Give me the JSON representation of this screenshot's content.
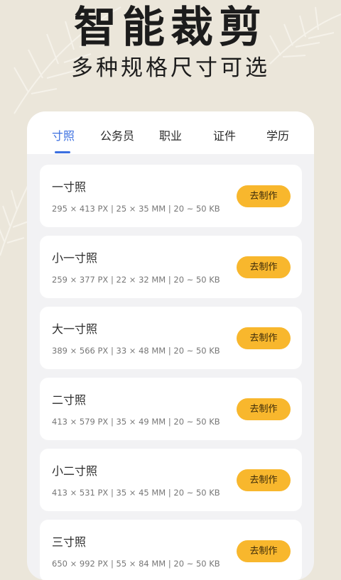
{
  "hero": {
    "title": "智能裁剪",
    "subtitle": "多种规格尺寸可选"
  },
  "tabs": [
    {
      "label": "寸照",
      "active": true
    },
    {
      "label": "公务员",
      "active": false
    },
    {
      "label": "职业",
      "active": false
    },
    {
      "label": "证件",
      "active": false
    },
    {
      "label": "学历",
      "active": false
    }
  ],
  "items": [
    {
      "title": "一寸照",
      "spec": "295 × 413 PX | 25 × 35 MM | 20 ~ 50 KB",
      "button": "去制作"
    },
    {
      "title": "小一寸照",
      "spec": "259 × 377 PX | 22 × 32 MM | 20 ~ 50 KB",
      "button": "去制作"
    },
    {
      "title": "大一寸照",
      "spec": "389 × 566 PX | 33 × 48 MM | 20 ~ 50 KB",
      "button": "去制作"
    },
    {
      "title": "二寸照",
      "spec": "413 × 579 PX | 35 × 49 MM | 20 ~ 50 KB",
      "button": "去制作"
    },
    {
      "title": "小二寸照",
      "spec": "413 × 531 PX | 35 × 45 MM | 20 ~ 50 KB",
      "button": "去制作"
    },
    {
      "title": "三寸照",
      "spec": "650 × 992 PX | 55 × 84 MM | 20 ~ 50 KB",
      "button": "去制作"
    }
  ],
  "colors": {
    "background": "#ebe6da",
    "accent": "#3b6fe0",
    "button": "#f8b72d"
  }
}
